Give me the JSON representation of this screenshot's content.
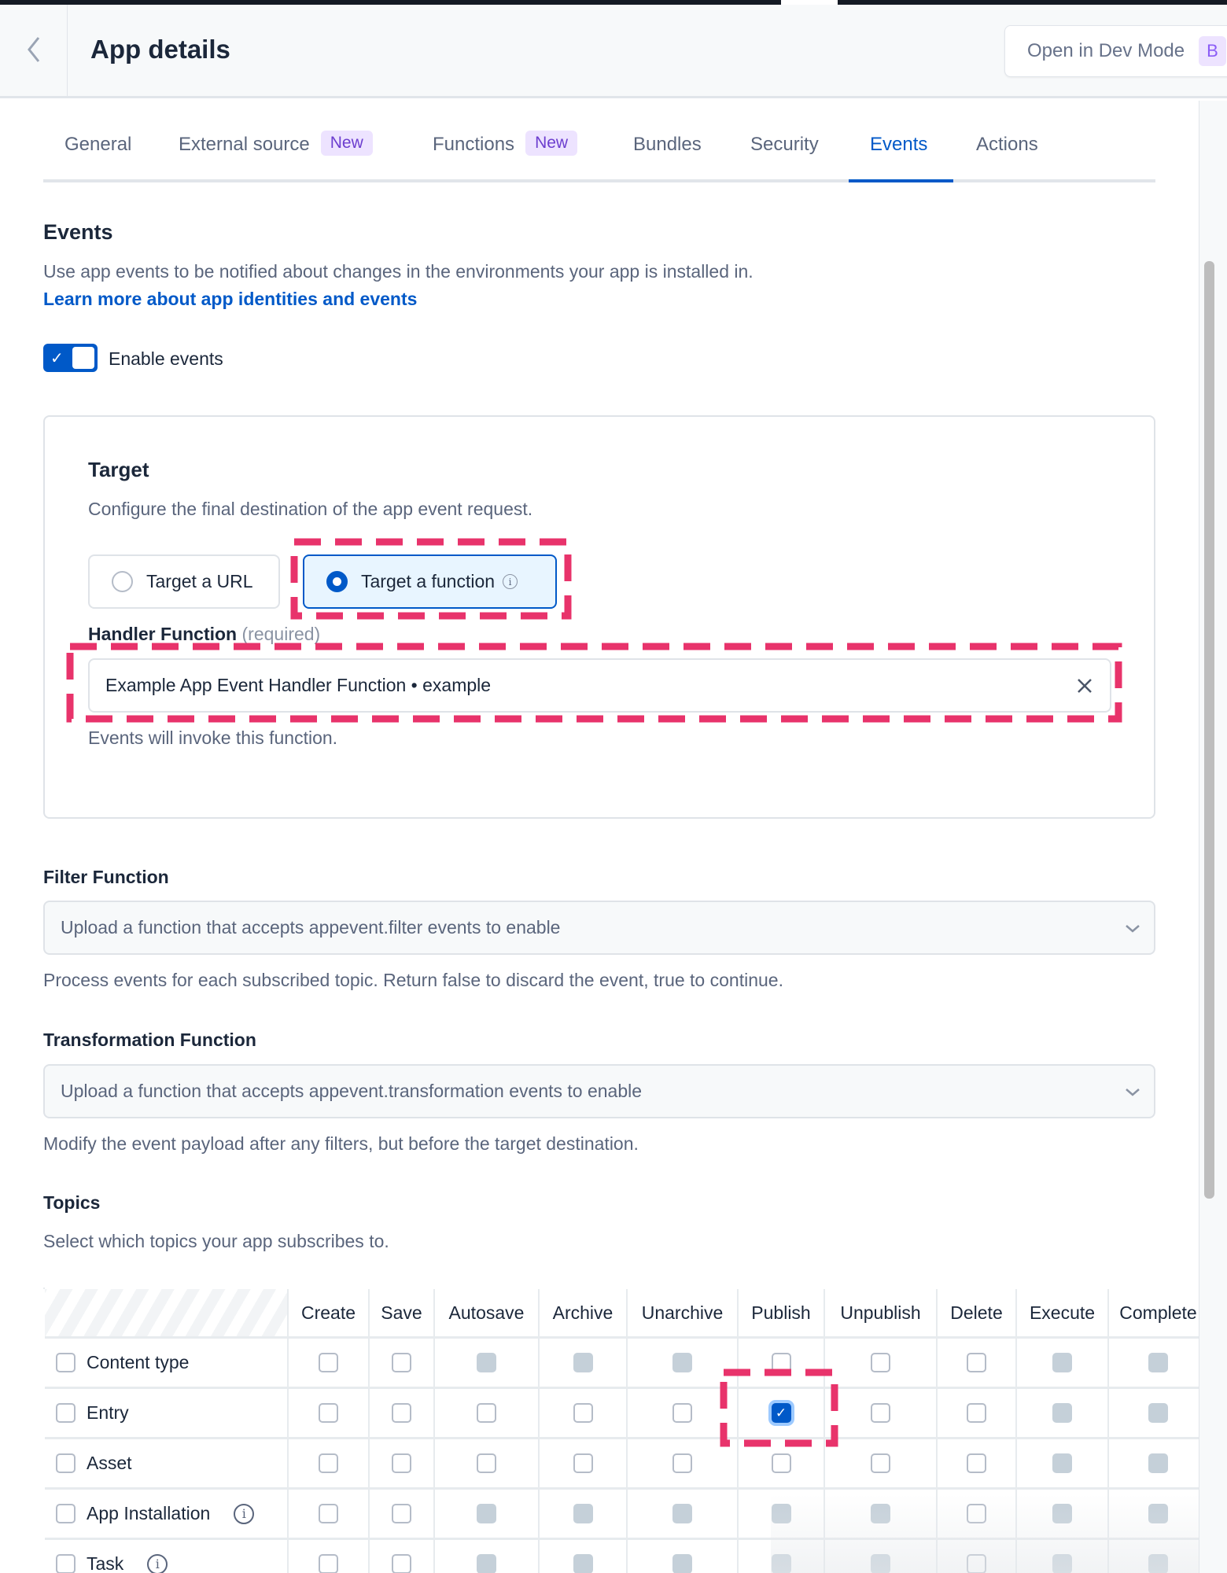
{
  "header": {
    "title": "App details",
    "dev_mode_button": "Open in Dev Mode",
    "dev_mode_badge": "B"
  },
  "tabs": [
    {
      "label": "General"
    },
    {
      "label": "External source",
      "badge": "New"
    },
    {
      "label": "Functions",
      "badge": "New"
    },
    {
      "label": "Bundles"
    },
    {
      "label": "Security"
    },
    {
      "label": "Events",
      "active": true
    },
    {
      "label": "Actions"
    }
  ],
  "events": {
    "heading": "Events",
    "description": "Use app events to be notified about changes in the environments your app is installed in.",
    "learn_more": "Learn more about app identities and events",
    "enable_label": "Enable events",
    "enabled": true
  },
  "target": {
    "heading": "Target",
    "description": "Configure the final destination of the app event request.",
    "option_url": "Target a URL",
    "option_function": "Target a function",
    "selected": "function",
    "handler_label": "Handler Function",
    "handler_required": "(required)",
    "handler_value": "Example App Event Handler Function • example",
    "handler_help": "Events will invoke this function."
  },
  "filter": {
    "label": "Filter Function",
    "placeholder": "Upload a function that accepts appevent.filter events to enable",
    "help": "Process events for each subscribed topic. Return false to discard the event, true to continue."
  },
  "transformation": {
    "label": "Transformation Function",
    "placeholder": "Upload a function that accepts appevent.transformation events to enable",
    "help": "Modify the event payload after any filters, but before the target destination."
  },
  "topics": {
    "heading": "Topics",
    "description": "Select which topics your app subscribes to.",
    "columns": [
      "Create",
      "Save",
      "Autosave",
      "Archive",
      "Unarchive",
      "Publish",
      "Unpublish",
      "Delete",
      "Execute",
      "Complete"
    ],
    "rows": [
      {
        "label": "Content type",
        "info": false,
        "cells": [
          "empty",
          "empty",
          "disabled",
          "disabled",
          "disabled",
          "empty",
          "empty",
          "empty",
          "disabled",
          "disabled"
        ]
      },
      {
        "label": "Entry",
        "info": false,
        "cells": [
          "empty",
          "empty",
          "empty",
          "empty",
          "empty",
          "checked",
          "empty",
          "empty",
          "disabled",
          "disabled"
        ]
      },
      {
        "label": "Asset",
        "info": false,
        "cells": [
          "empty",
          "empty",
          "empty",
          "empty",
          "empty",
          "empty",
          "empty",
          "empty",
          "disabled",
          "disabled"
        ]
      },
      {
        "label": "App Installation",
        "info": true,
        "cells": [
          "empty",
          "empty",
          "disabled",
          "disabled",
          "disabled",
          "disabled",
          "disabled",
          "empty",
          "disabled",
          "disabled"
        ]
      },
      {
        "label": "Task",
        "info": true,
        "cells": [
          "empty",
          "empty",
          "disabled",
          "disabled",
          "disabled",
          "disabled",
          "disabled",
          "empty",
          "disabled",
          "disabled"
        ]
      }
    ]
  },
  "colors": {
    "accent": "#0059c8",
    "highlight": "#e8336b",
    "badge_bg": "#ede3ff"
  }
}
